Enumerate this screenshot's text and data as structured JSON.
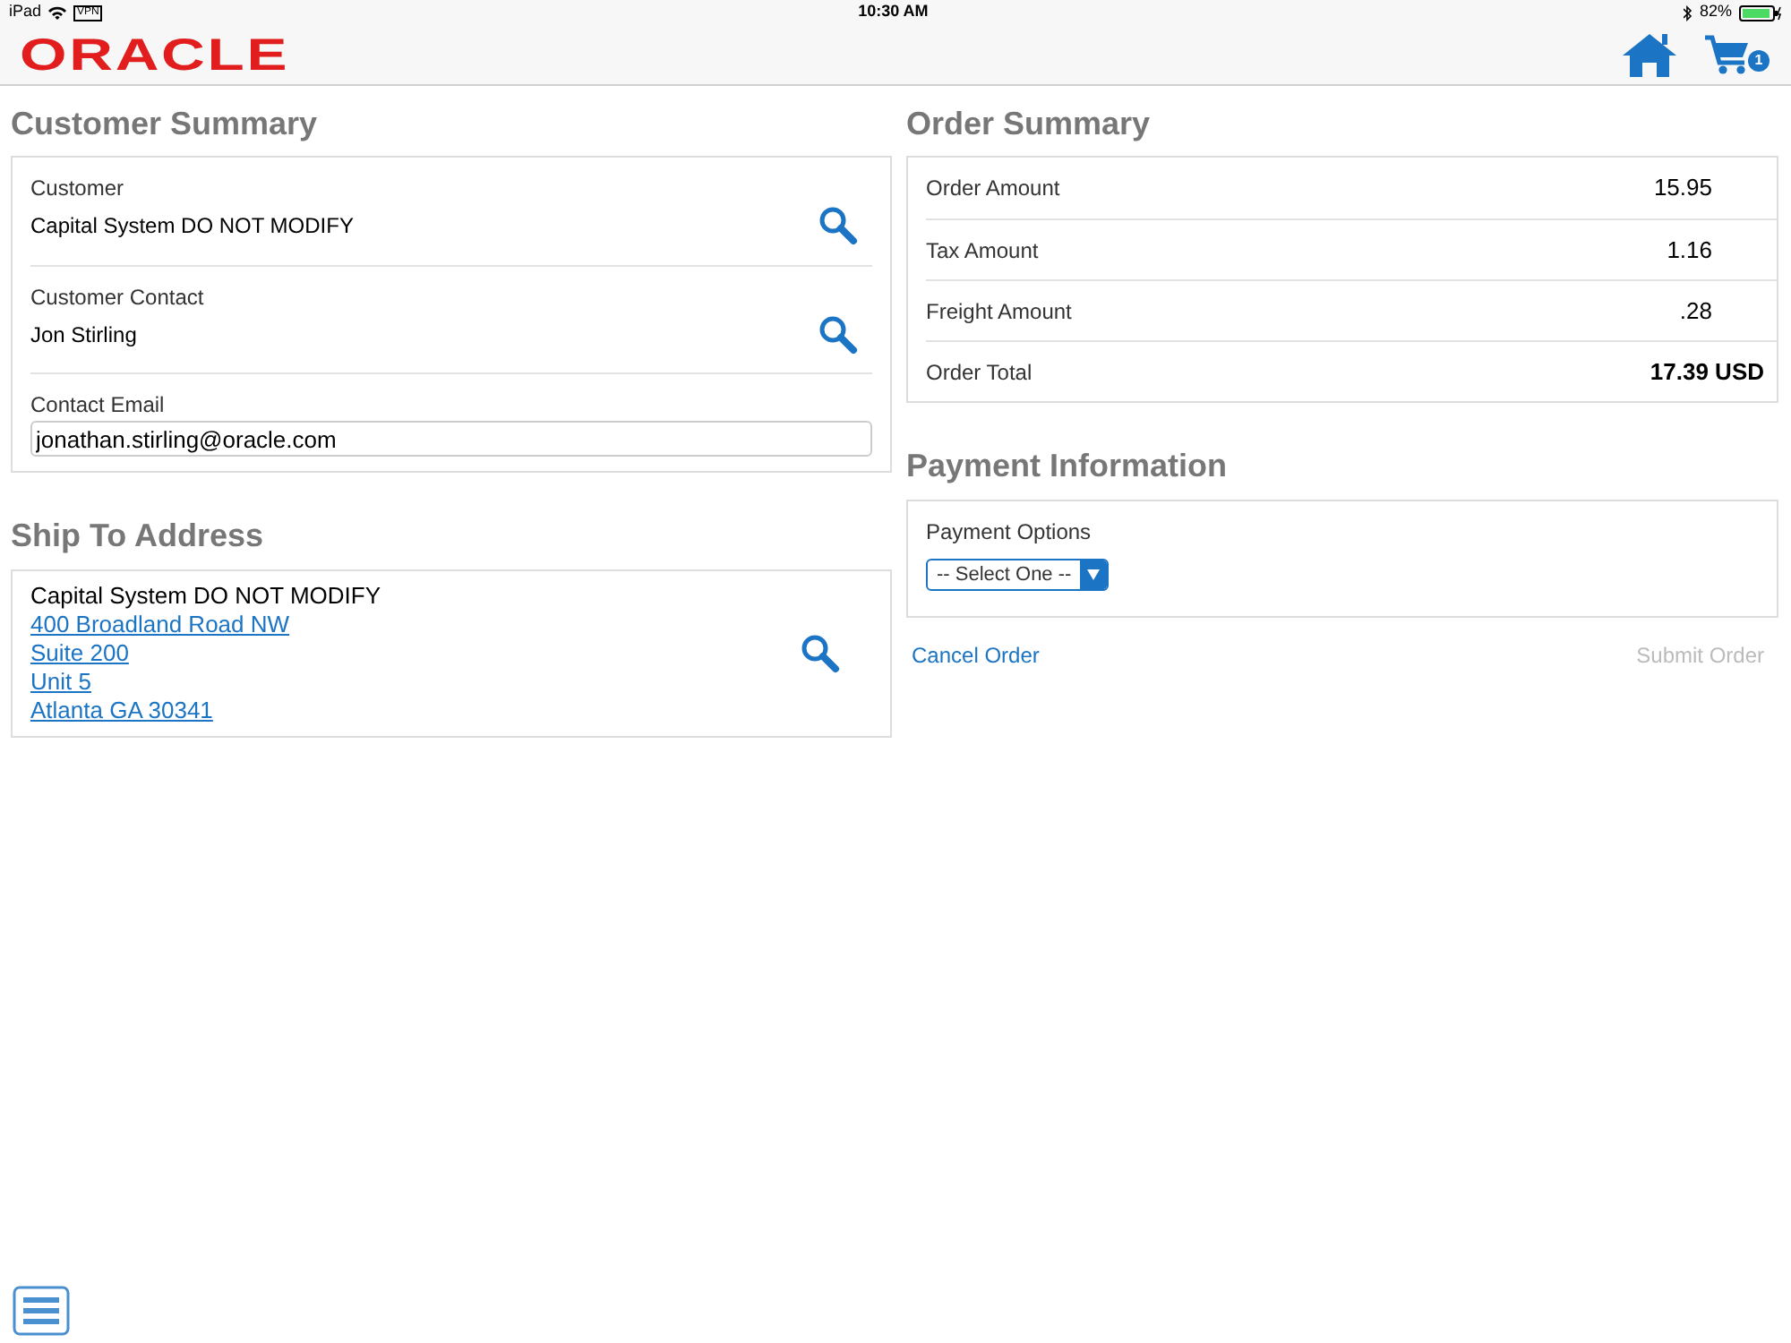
{
  "status_bar": {
    "device": "iPad",
    "vpn": "VPN",
    "time": "10:30 AM",
    "battery": "82%"
  },
  "header": {
    "logo": "ORACLE",
    "cart_count": "1"
  },
  "customer_summary": {
    "title": "Customer Summary",
    "fields": [
      {
        "label": "Customer",
        "value": "Capital System DO NOT MODIFY",
        "kind": "lookup"
      },
      {
        "label": "Customer Contact",
        "value": "Jon Stirling",
        "kind": "lookup"
      },
      {
        "label": "Contact Email",
        "value": "jonathan.stirling@oracle.com",
        "kind": "input"
      }
    ]
  },
  "ship_to": {
    "title": "Ship To Address",
    "name": "Capital System DO NOT MODIFY",
    "lines": [
      "400 Broadland Road NW",
      "Suite 200",
      "Unit 5",
      "Atlanta GA 30341"
    ]
  },
  "order_summary": {
    "title": "Order Summary",
    "rows": [
      {
        "label": "Order Amount",
        "value": "15.95",
        "kind": "amount"
      },
      {
        "label": "Tax Amount",
        "value": "1.16",
        "kind": "amount"
      },
      {
        "label": "Freight Amount",
        "value": ".28",
        "kind": "amount"
      },
      {
        "label": "Order Total",
        "value": "17.39 USD",
        "kind": "total"
      }
    ]
  },
  "payment": {
    "title": "Payment Information",
    "label": "Payment Options",
    "select": "-- Select One --"
  },
  "actions": [
    {
      "label": "Cancel Order",
      "disabled": false
    },
    {
      "label": "Submit Order",
      "disabled": true
    }
  ]
}
